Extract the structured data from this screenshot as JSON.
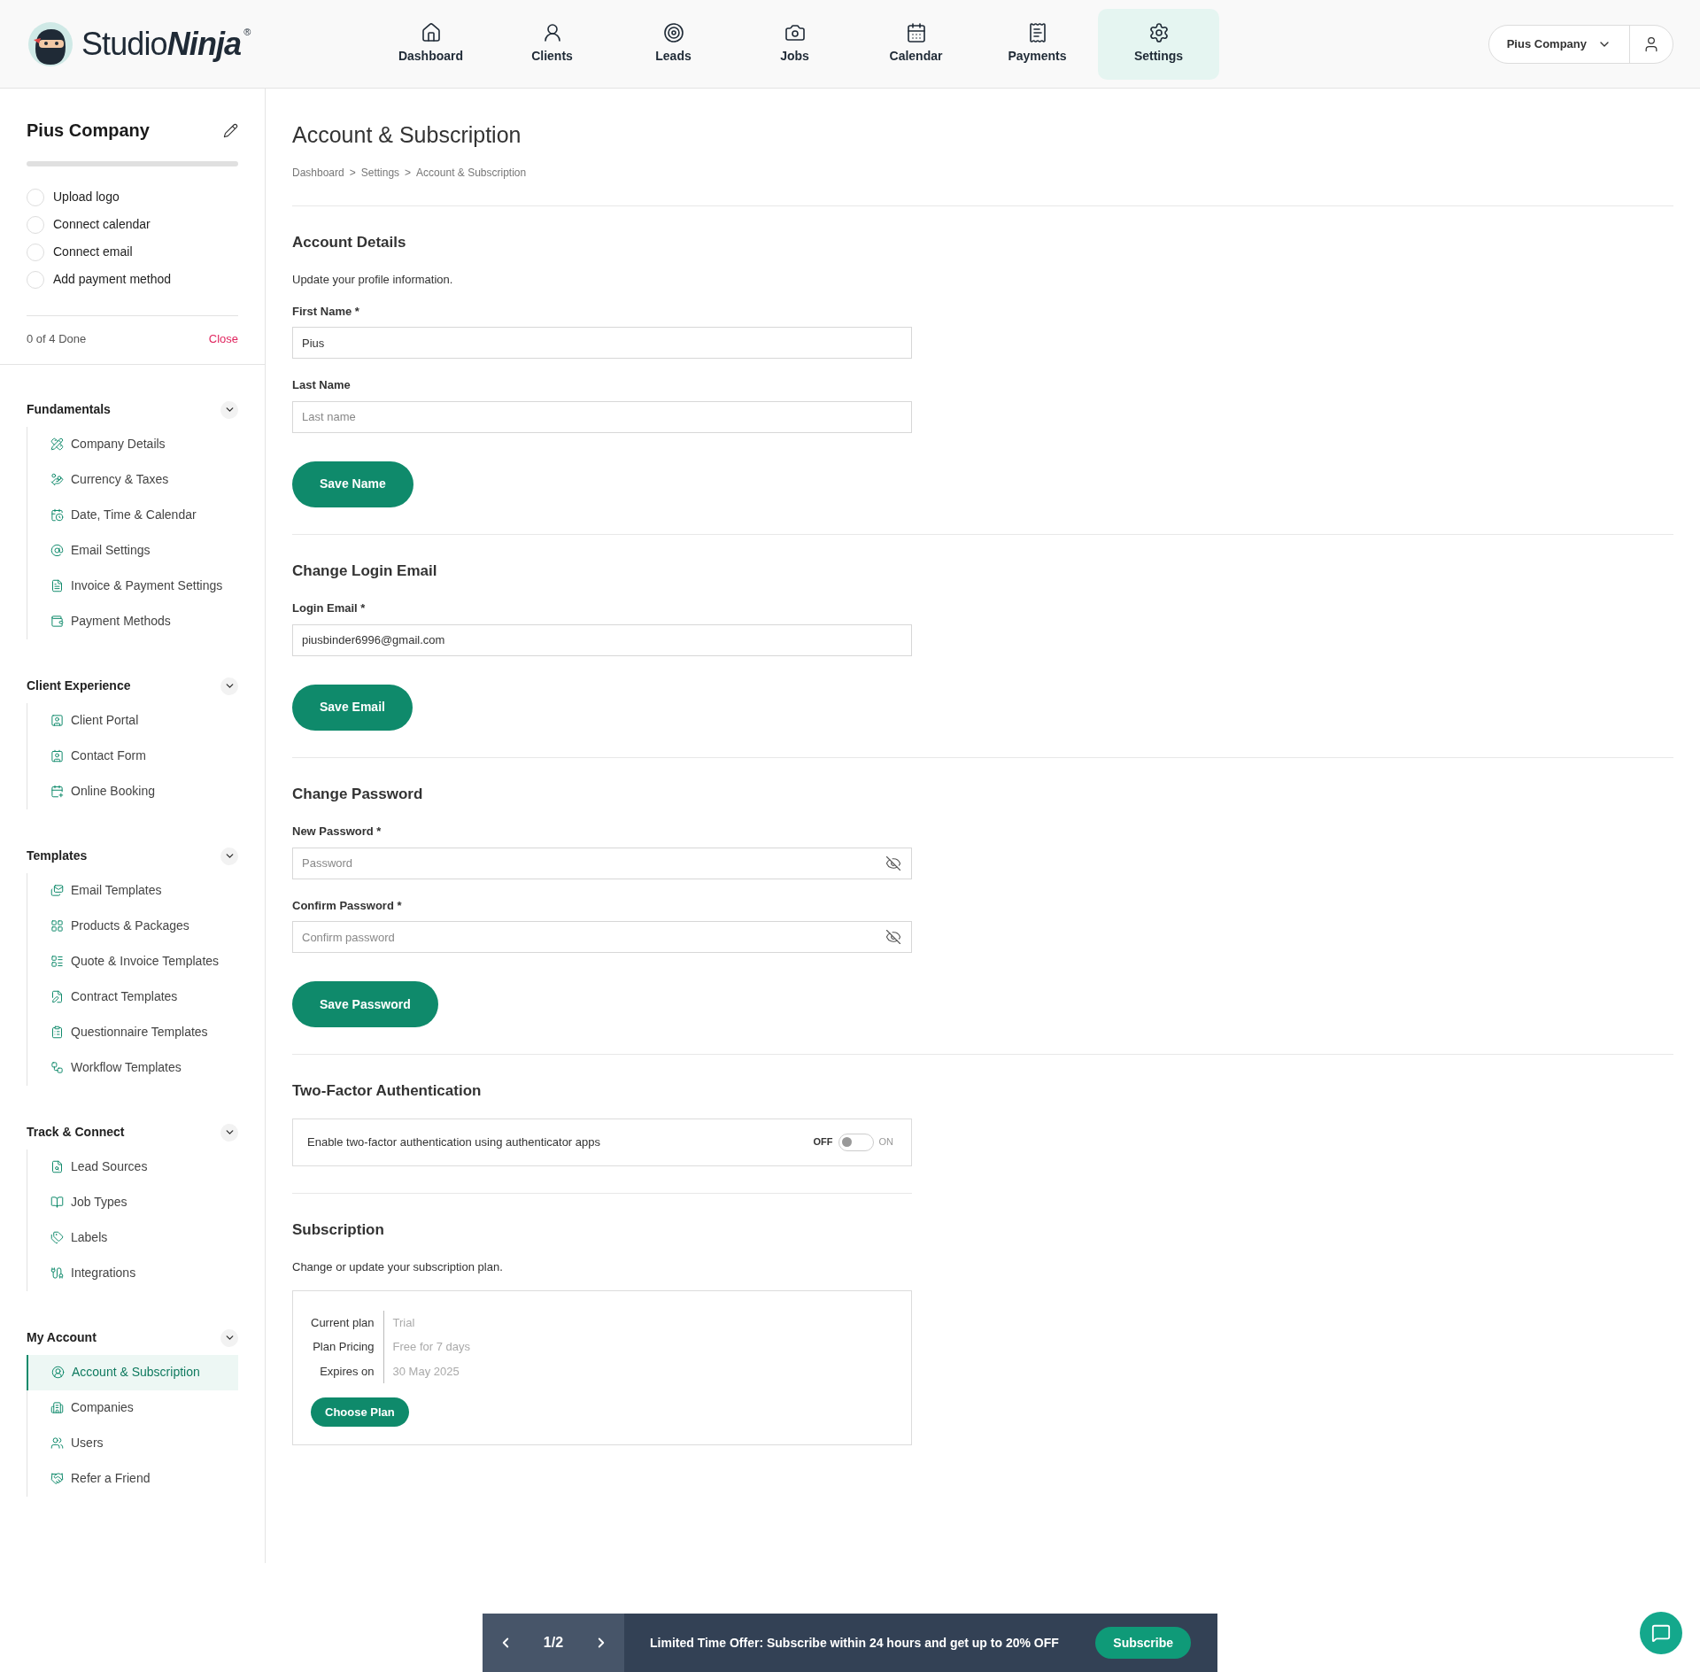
{
  "nav": {
    "logo_light": "Studio",
    "logo_bold": "Ninja",
    "logo_mark": "®",
    "items": [
      {
        "label": "Dashboard",
        "selected": false
      },
      {
        "label": "Clients",
        "selected": false
      },
      {
        "label": "Leads",
        "selected": false
      },
      {
        "label": "Jobs",
        "selected": false
      },
      {
        "label": "Calendar",
        "selected": false
      },
      {
        "label": "Payments",
        "selected": false
      },
      {
        "label": "Settings",
        "selected": true
      }
    ],
    "company_select": "Pius Company"
  },
  "sidebar": {
    "company": "Pius Company",
    "progress": {
      "level": 0
    },
    "checklist": [
      {
        "label": "Upload logo",
        "checked": false
      },
      {
        "label": "Connect calendar",
        "checked": false
      },
      {
        "label": "Connect email",
        "checked": false
      },
      {
        "label": "Add payment method",
        "checked": false
      }
    ],
    "done_text": "0 of 4 Done",
    "close": "Close",
    "groups": [
      {
        "title": "Fundamentals",
        "expanded": true,
        "items": [
          {
            "label": "Company Details",
            "selected": false
          },
          {
            "label": "Currency & Taxes",
            "selected": false
          },
          {
            "label": "Date, Time & Calendar",
            "selected": false
          },
          {
            "label": "Email Settings",
            "selected": false
          },
          {
            "label": "Invoice & Payment Settings",
            "selected": false
          },
          {
            "label": "Payment Methods",
            "selected": false
          }
        ]
      },
      {
        "title": "Client Experience",
        "expanded": true,
        "items": [
          {
            "label": "Client Portal",
            "selected": false
          },
          {
            "label": "Contact Form",
            "selected": false
          },
          {
            "label": "Online Booking",
            "selected": false
          }
        ]
      },
      {
        "title": "Templates",
        "expanded": true,
        "items": [
          {
            "label": "Email Templates",
            "selected": false
          },
          {
            "label": "Products & Packages",
            "selected": false
          },
          {
            "label": "Quote & Invoice Templates",
            "selected": false
          },
          {
            "label": "Contract Templates",
            "selected": false
          },
          {
            "label": "Questionnaire Templates",
            "selected": false
          },
          {
            "label": "Workflow Templates",
            "selected": false
          }
        ]
      },
      {
        "title": "Track & Connect",
        "expanded": true,
        "items": [
          {
            "label": "Lead Sources",
            "selected": false
          },
          {
            "label": "Job Types",
            "selected": false
          },
          {
            "label": "Labels",
            "selected": false
          },
          {
            "label": "Integrations",
            "selected": false
          }
        ]
      },
      {
        "title": "My Account",
        "expanded": true,
        "items": [
          {
            "label": "Account & Subscription",
            "selected": true
          },
          {
            "label": "Companies",
            "selected": false
          },
          {
            "label": "Users",
            "selected": false
          },
          {
            "label": "Refer a Friend",
            "selected": false
          }
        ]
      }
    ]
  },
  "page": {
    "title": "Account & Subscription",
    "breadcrumb": [
      "Dashboard",
      "Settings",
      "Account & Subscription"
    ],
    "breadcrumb_sep": ">",
    "account": {
      "title": "Account Details",
      "description": "Update your profile information.",
      "fields": [
        {
          "label": "First Name *",
          "value": "Pius"
        },
        {
          "label": "Last Name",
          "placeholder": "Last name"
        }
      ],
      "button": "Save Name"
    },
    "email": {
      "title": "Change Login Email",
      "fields": [
        {
          "label": "Login Email *",
          "value": "piusbinder6996@gmail.com"
        }
      ],
      "button": "Save Email"
    },
    "password": {
      "title": "Change Password",
      "fields": [
        {
          "label": "New Password *",
          "placeholder": "Password"
        },
        {
          "label": "Confirm Password *",
          "placeholder": "Confirm password"
        }
      ],
      "button": "Save Password"
    },
    "two_factor": {
      "title": "Two-Factor Authentication",
      "text": "Enable two-factor authentication using authenticator apps",
      "off_label": "OFF",
      "on_label": "ON",
      "on": false
    },
    "subscription": {
      "title": "Subscription",
      "description": "Change or update your subscription plan.",
      "rows": [
        {
          "label": "Current plan",
          "value": "Trial"
        },
        {
          "label": "Plan Pricing",
          "value": "Free for 7 days"
        },
        {
          "label": "Expires on",
          "value": "30 May 2025"
        }
      ],
      "button": "Choose Plan"
    }
  },
  "banner": {
    "page": "1/2",
    "text": "Limited Time Offer: Subscribe within 24 hours and get up to 20% OFF",
    "button": "Subscribe"
  }
}
